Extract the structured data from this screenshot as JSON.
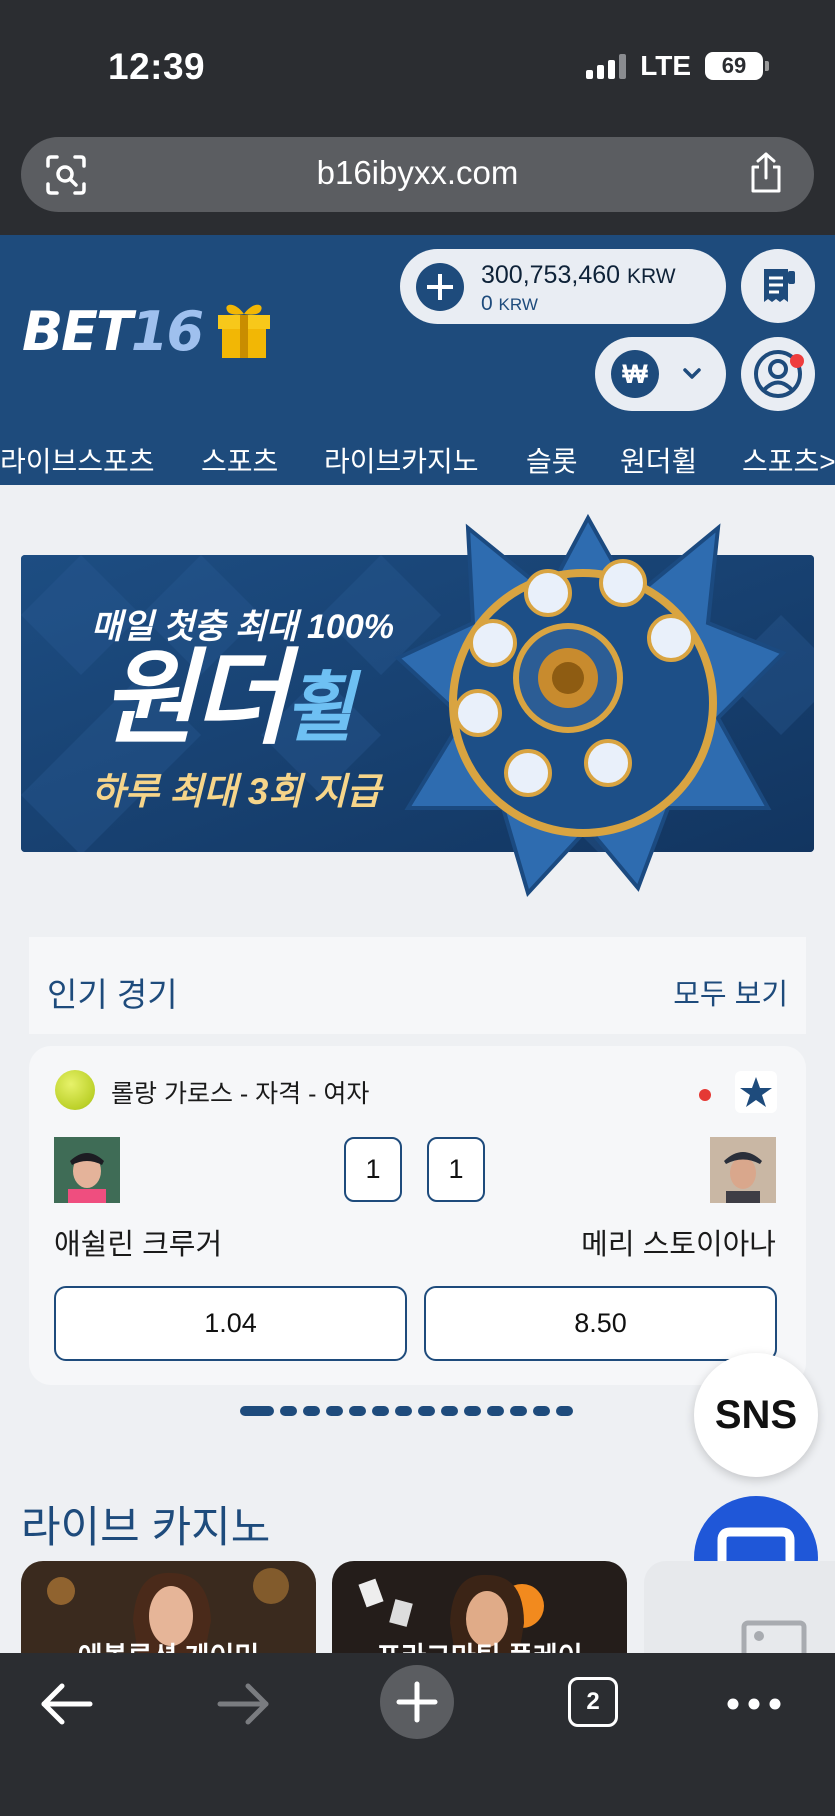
{
  "status": {
    "time": "12:39",
    "network": "LTE",
    "battery": "69"
  },
  "browser": {
    "url": "b16ibyxx.com",
    "tab_count": "2"
  },
  "site": {
    "logo_text": "BET",
    "logo_number": "16",
    "balance": {
      "main_amount": "300,753,460",
      "main_currency": "KRW",
      "sub_amount": "0",
      "sub_currency": "KRW"
    },
    "currency_symbol": "₩"
  },
  "nav": {
    "items": [
      "라이브스포츠",
      "스포츠",
      "라이브카지노",
      "슬롯",
      "원더휠",
      "스포츠>"
    ]
  },
  "banner": {
    "line1": "매일 첫충 최대 100%",
    "title_part1": "원더",
    "title_part2": "휠",
    "line3": "하루 최대 3회 지급"
  },
  "popular": {
    "title": "인기 경기",
    "view_all": "모두 보기"
  },
  "match": {
    "league": "롤랑 가로스 - 자격 - 여자",
    "home_team": "애쉴린 크루거",
    "away_team": "메리 스토이아나",
    "home_score": "1",
    "away_score": "1",
    "home_odds": "1.04",
    "away_odds": "8.50"
  },
  "carousel": {
    "total_pages": 14,
    "active_index": 0
  },
  "floating": {
    "sns_label": "SNS"
  },
  "casino": {
    "title": "라이브 카지노",
    "games": [
      {
        "label": "에볼루션 게이밍"
      },
      {
        "label": "프라그마틱 플레이"
      }
    ]
  },
  "colors": {
    "brand": "#1e4b7c",
    "accent_gold": "#f2b705",
    "chat_blue": "#1f57d8",
    "live_red": "#e53935"
  },
  "icons": [
    "screen-search-icon",
    "share-icon",
    "gift-icon",
    "plus-icon",
    "receipt-icon",
    "won-icon",
    "chevron-down-icon",
    "profile-icon",
    "tennis-ball-icon",
    "star-icon",
    "chat-icon",
    "back-icon",
    "forward-icon",
    "new-tab-icon",
    "tabs-icon",
    "more-icon"
  ]
}
